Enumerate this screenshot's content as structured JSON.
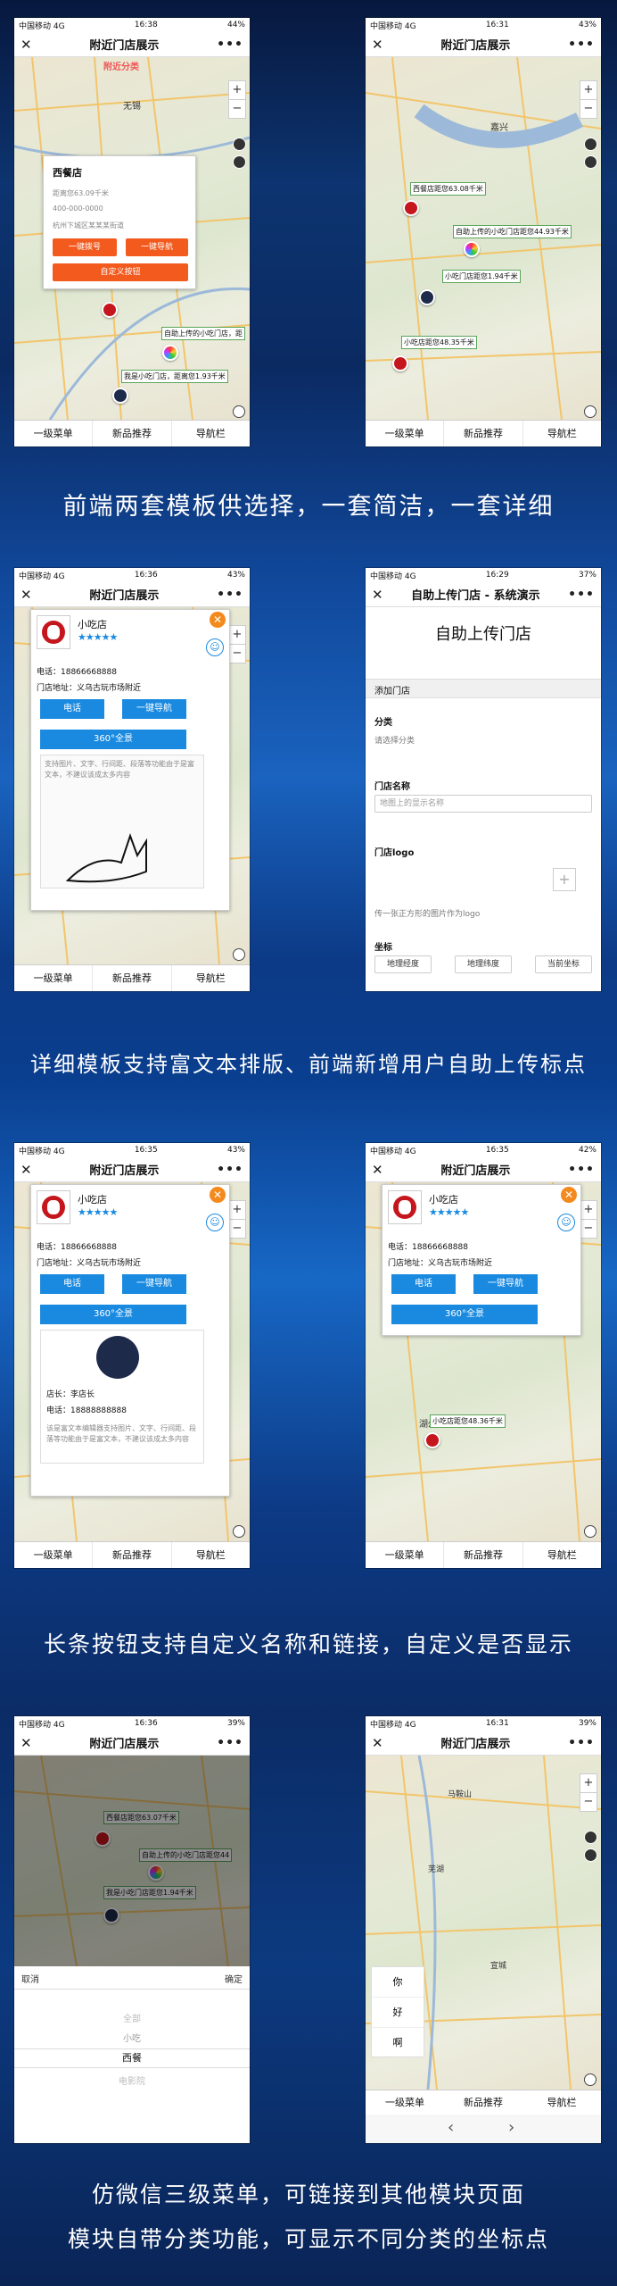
{
  "captions": [
    "前端两套模板供选择，一套简洁，一套详细",
    "详细模板支持富文本排版、前端新增用户自助上传标点",
    "长条按钮支持自定义名称和链接，自定义是否显示",
    "仿微信三级菜单，可链接到其他模块页面",
    "模块自带分类功能，可显示不同分类的坐标点"
  ],
  "common": {
    "carrier": "中国移动",
    "net": "4G",
    "title": "附近门店展示",
    "close": "✕",
    "more": "•••",
    "zoom_in": "+",
    "zoom_out": "−",
    "tabs": [
      "一级菜单",
      "新品推荐",
      "导航栏"
    ]
  },
  "p1": {
    "time": "16:38",
    "battery": "44%",
    "wm": "附近分类",
    "shop": "西餐店",
    "dist": "距离您63.09千米",
    "phone": "400-000-0000",
    "addr": "杭州下城区某某某街道",
    "btn1": "一键拨号",
    "btn2": "一键导航",
    "btn3": "自定义按钮",
    "city": "无锡",
    "lbl1": "自助上传的小吃门店，距",
    "lbl2": "我是小吃门店，距离您1.93千米"
  },
  "p2": {
    "time": "16:31",
    "battery": "43%",
    "lbl1": "西餐店距您63.08千米",
    "lbl2": "自助上传的小吃门店距您44.93千米",
    "lbl3": "小吃门店距您1.94千米",
    "lbl4": "小吃店距您48.35千米",
    "city": "嘉兴"
  },
  "p3": {
    "time": "16:36",
    "battery": "43%",
    "shop": "小吃店",
    "stars": "★★★★★",
    "tel": "电话：18866668888",
    "addr": "门店地址：义乌古玩市场附近",
    "b_tel": "电话",
    "b_nav": "一键导航",
    "b_360": "360°全景",
    "rich": "支持图片、文字、行间距、段落等功能由于是富文本，不建议该成太多内容"
  },
  "p4": {
    "time": "16:29",
    "battery": "37%",
    "title": "自助上传门店 - 系统演示",
    "big": "自助上传门店",
    "section": "添加门店",
    "cat": "分类",
    "cat_val": "请选择分类",
    "name": "门店名称",
    "name_ph": "地图上的显示名称",
    "logo": "门店logo",
    "logo_tip": "传一张正方形的图片作为logo",
    "coord": "坐标",
    "lng": "地理经度",
    "lat": "地理纬度",
    "cur": "当前坐标"
  },
  "p5": {
    "time": "16:35",
    "battery": "43%",
    "mgr": "店长：李店长",
    "mgr_tel": "电话：18888888888",
    "rich": "该是富文本编辑器支持图片、文字、行间距、段落等功能由于是富文本，不建议该成太多内容"
  },
  "p6": {
    "time": "16:35",
    "battery": "42%",
    "lbl": "小吃店距您48.36千米",
    "city": "湖州"
  },
  "p7": {
    "time": "16:36",
    "battery": "39%",
    "cancel": "取消",
    "confirm": "确定",
    "opts": [
      "全部",
      "小吃",
      "西餐",
      "电影院"
    ],
    "lbl1": "西餐店距您63.07千米",
    "lbl2": "自助上传的小吃门店距您44",
    "lbl3": "我是小吃门店距您1.94千米"
  },
  "p8": {
    "time": "16:31",
    "battery": "39%",
    "menu": [
      "你",
      "好",
      "啊"
    ],
    "prev": "‹",
    "next": "›",
    "city1": "马鞍山",
    "city2": "芜湖",
    "city3": "宣城"
  }
}
